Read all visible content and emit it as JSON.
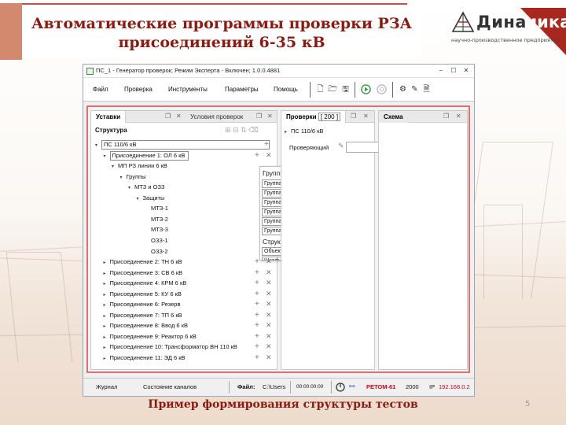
{
  "slide": {
    "title_line1": "Автоматические программы проверки РЗА",
    "title_line2": "присоединений 6-35 кВ",
    "caption": "Пример формирования структуры тестов",
    "page_number": "5",
    "logo": {
      "text_dark": "Дина",
      "text_light": "мика",
      "subtitle": "научно-производственное предприятие",
      "accent_color": "#a8271e"
    },
    "title_color": "#8b1a10"
  },
  "window": {
    "title": "ПС_1 - Генератор проверок; Режим Эксперта - Включен; 1.0.0.4881",
    "controls": {
      "minimize": "–",
      "maximize": "☐",
      "close": "✕"
    },
    "menu": [
      "Файл",
      "Проверка",
      "Инструменты",
      "Параметры",
      "Помощь"
    ],
    "toolbar_icons": [
      "new-file-icon",
      "open-folder-icon",
      "save-icon",
      "run-icon",
      "stop-icon",
      "settings-icon",
      "edit-icon",
      "document-icon"
    ]
  },
  "panes": {
    "left": {
      "tabs": [
        "Уставки",
        "Условия проверок"
      ],
      "header": "Структура"
    },
    "middle": {
      "tab": "Проверки",
      "count": "[ 200 ]",
      "root": "ПС 110/6 кВ",
      "checker_label": "Проверяющий",
      "checker_value": ""
    },
    "right": {
      "tab": "Схема"
    }
  },
  "tree": [
    {
      "label": "ПС 110/6 кВ",
      "level": 0,
      "arrow": "▾",
      "boxed": true,
      "actions": "plus"
    },
    {
      "label": "Присоединение 1: ОЛ 6 кВ",
      "level": 1,
      "arrow": "▾",
      "boxed": true,
      "actions": "both"
    },
    {
      "label": "МП РЗ линии 6 кВ",
      "level": 2,
      "arrow": "▾",
      "boxed": false,
      "actions": "none"
    },
    {
      "label": "Группы",
      "level": 3,
      "arrow": "▾",
      "boxed": false,
      "actions": "none"
    },
    {
      "label": "МТЗ и ОЗЗ",
      "level": 4,
      "arrow": "▾",
      "boxed": false,
      "actions": "none"
    },
    {
      "label": "Защиты",
      "level": 5,
      "arrow": "▾",
      "boxed": false,
      "actions": "none"
    },
    {
      "label": "МТЗ-1",
      "level": 6,
      "arrow": "",
      "boxed": false,
      "actions": "none"
    },
    {
      "label": "МТЗ-2",
      "level": 6,
      "arrow": "",
      "boxed": false,
      "actions": "none"
    },
    {
      "label": "МТЗ-3",
      "level": 6,
      "arrow": "",
      "boxed": false,
      "actions": "none"
    },
    {
      "label": "ОЗЗ-1",
      "level": 6,
      "arrow": "",
      "boxed": false,
      "actions": "none"
    },
    {
      "label": "ОЗЗ-2",
      "level": 6,
      "arrow": "",
      "boxed": false,
      "actions": "none"
    },
    {
      "label": "Присоединение 2: ТН 6 кВ",
      "level": 1,
      "arrow": "▸",
      "boxed": false,
      "actions": "both"
    },
    {
      "label": "Присоединение 3: СВ 6 кВ",
      "level": 1,
      "arrow": "▸",
      "boxed": false,
      "actions": "both"
    },
    {
      "label": "Присоединение 4: КРМ 6 кВ",
      "level": 1,
      "arrow": "▸",
      "boxed": false,
      "actions": "both"
    },
    {
      "label": "Присоединение 5: КУ 6 кВ",
      "level": 1,
      "arrow": "▸",
      "boxed": false,
      "actions": "both"
    },
    {
      "label": "Присоединение 6: Резерв",
      "level": 1,
      "arrow": "▸",
      "boxed": false,
      "actions": "both"
    },
    {
      "label": "Присоединение 7: ТП 6 кВ",
      "level": 1,
      "arrow": "▸",
      "boxed": false,
      "actions": "both"
    },
    {
      "label": "Присоединение 8: Ввод 6 кВ",
      "level": 1,
      "arrow": "▸",
      "boxed": false,
      "actions": "both"
    },
    {
      "label": "Присоединение 9: Реактор 6 кВ",
      "level": 1,
      "arrow": "▸",
      "boxed": false,
      "actions": "both"
    },
    {
      "label": "Присоединение 10: Трансформатор ВН 110 кВ",
      "level": 1,
      "arrow": "▸",
      "boxed": false,
      "actions": "both"
    },
    {
      "label": "Присоединение 11: ЭД 6 кВ",
      "level": 1,
      "arrow": "▸",
      "boxed": false,
      "actions": "both"
    }
  ],
  "popup": {
    "groups_header": "Группы защит",
    "groups": [
      "Группа логики",
      "Группа РС",
      "Группа РМ",
      "Группа РН",
      "Группа РТ",
      "Группа РЧ"
    ],
    "structure_header": "Структура",
    "structure": [
      "Объект",
      "Шкаф"
    ]
  },
  "status": {
    "journal": "Журнал",
    "channels": "Состояние каналов",
    "file_label": "Файл:",
    "file_value": "C:\\Users",
    "time": "00:00:00:00",
    "device": "РЕТОМ-61",
    "device_color": "#d0021b",
    "port": "2000",
    "ip_label": "IP",
    "ip_value": "192.168.0.2"
  }
}
